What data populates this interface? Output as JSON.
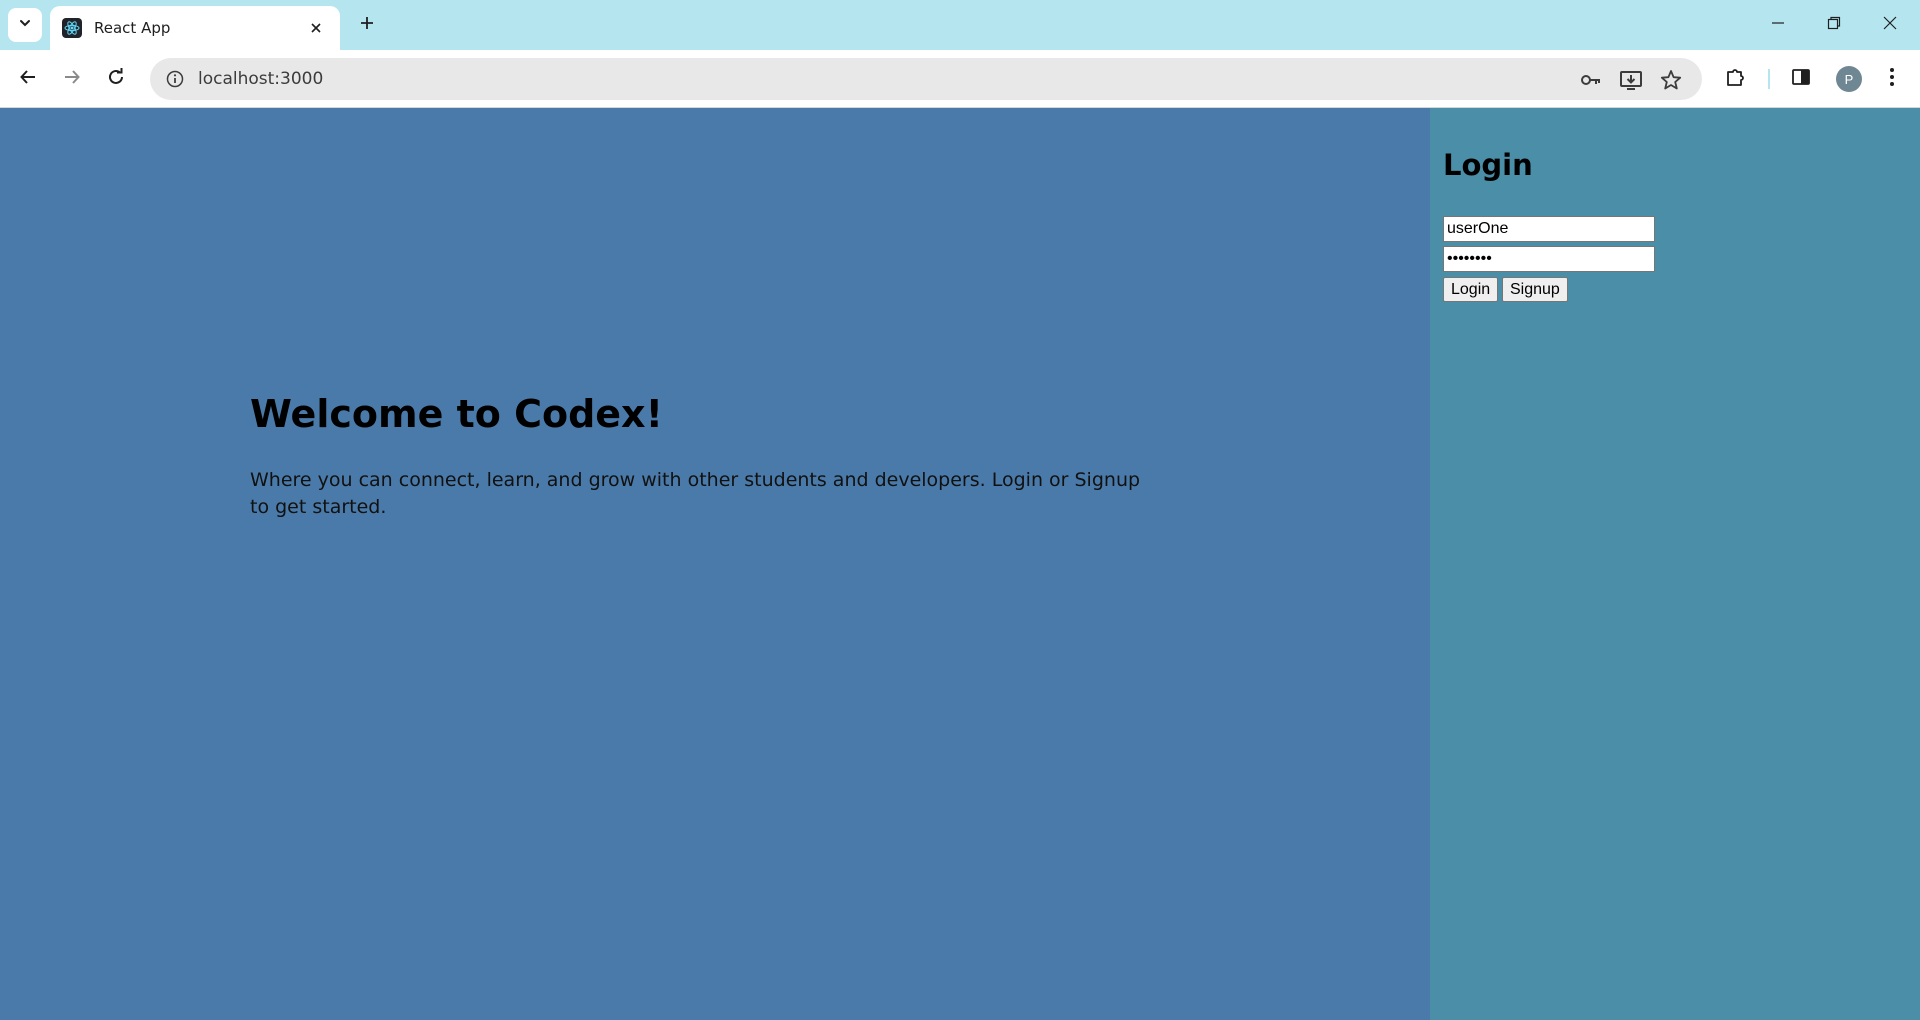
{
  "browser": {
    "tab": {
      "title": "React App",
      "favicon": "react-logo-icon"
    },
    "url": "localhost:3000",
    "profile_initial": "P",
    "icons": {
      "tab_search": "chevron-down-icon",
      "new_tab": "plus-icon",
      "minimize": "minimize-icon",
      "restore": "restore-icon",
      "close": "close-icon",
      "back": "back-arrow-icon",
      "forward": "forward-arrow-icon",
      "reload": "reload-icon",
      "site_info": "info-icon",
      "passwords": "key-icon",
      "install": "install-app-icon",
      "bookmark": "star-icon",
      "extensions": "puzzle-icon",
      "side_panel": "side-panel-icon",
      "menu": "kebab-menu-icon"
    }
  },
  "main": {
    "title": "Welcome to Codex!",
    "description": "Where you can connect, learn, and grow with other students and developers. Login or Signup to get started."
  },
  "login": {
    "title": "Login",
    "username_value": "userOne",
    "password_value": "password",
    "login_label": "Login",
    "signup_label": "Signup"
  },
  "colors": {
    "main_bg": "#4a7aa9",
    "sidebar_bg": "#4a8ea7",
    "tabstrip_bg": "#b5e6f0"
  }
}
